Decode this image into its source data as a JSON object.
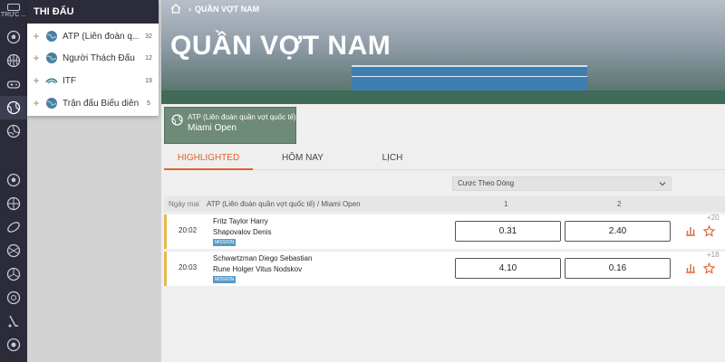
{
  "rail": {
    "live_label": "TRỰC ...",
    "icons": [
      "soccer-icon",
      "basketball-icon",
      "esports-icon",
      "tennis-icon",
      "volleyball-icon",
      "soccer-icon",
      "basketball-icon",
      "rugby-icon",
      "volleyball-icon",
      "volleyball-icon",
      "handball-icon",
      "baseball-icon",
      "hockey-icon",
      "pool-icon"
    ]
  },
  "competitions": {
    "header": "THI ĐẤU",
    "items": [
      {
        "label": "ATP (Liên đoàn q...",
        "count": "32",
        "icon": "globe-icon"
      },
      {
        "label": "Người Thách Đấu",
        "count": "12",
        "icon": "globe-icon"
      },
      {
        "label": "ITF",
        "count": "19",
        "icon": "itf-logo-icon"
      },
      {
        "label": "Trận đấu Biểu diễn",
        "count": "5",
        "icon": "globe-icon"
      }
    ]
  },
  "breadcrumb": {
    "current": "QUẦN VỢT NAM"
  },
  "hero": {
    "title": "QUẦN VỢT NAM"
  },
  "league_card": {
    "line1": "ATP (Liên đoàn quần vợt quốc tế)",
    "line2": "Miami Open"
  },
  "tabs": [
    {
      "label": "HIGHLIGHTED",
      "active": true
    },
    {
      "label": "HÔM NAY",
      "active": false
    },
    {
      "label": "LỊCH",
      "active": false
    }
  ],
  "market_select": {
    "value": "Cược Theo Dòng"
  },
  "group": {
    "day": "Ngày mai",
    "title": "ATP (Liên đoàn quần vợt quốc tế)  /  Miami Open",
    "col1": "1",
    "col2": "2"
  },
  "matches": [
    {
      "time": "20:02",
      "team1": "Fritz Taylor Harry",
      "team2": "Shapovalov Denis",
      "badge": "MISSION",
      "odd1": "0.31",
      "odd2": "2.40",
      "more": "+20"
    },
    {
      "time": "20:03",
      "team1": "Schwartzman Diego Sebastian",
      "team2": "Rune Holger Vitus Nodskov",
      "badge": "MISSION",
      "odd1": "4.10",
      "odd2": "0.16",
      "more": "+18"
    }
  ],
  "colors": {
    "accent": "#e0622d",
    "rail": "#2b2b3a",
    "highlight_border": "#e8b84a"
  }
}
